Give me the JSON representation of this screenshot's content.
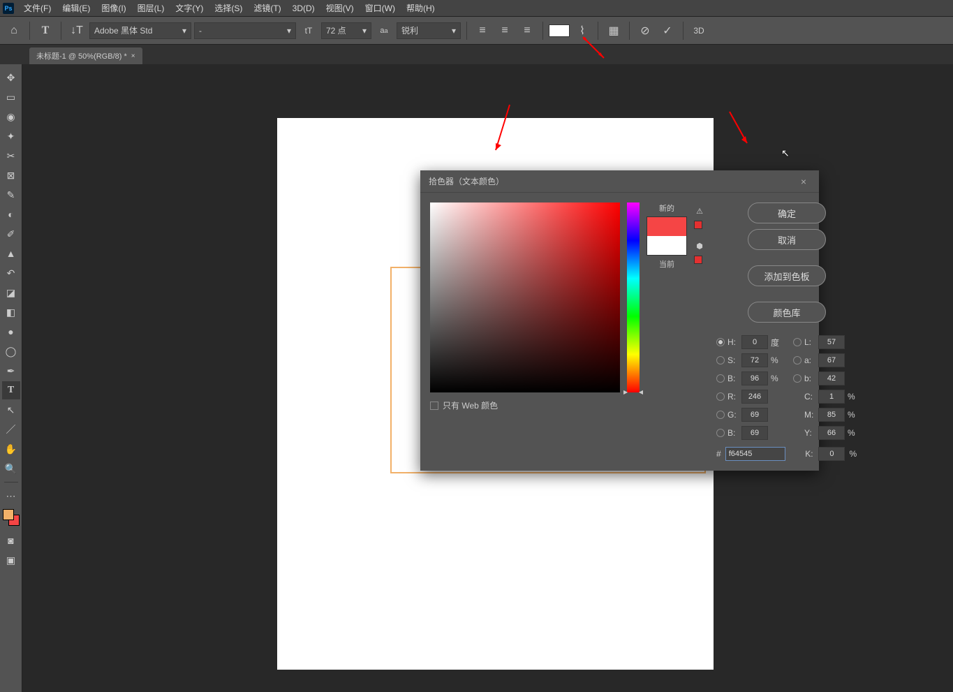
{
  "menu": {
    "file": "文件(F)",
    "edit": "编辑(E)",
    "image": "图像(I)",
    "layer": "图层(L)",
    "type": "文字(Y)",
    "select": "选择(S)",
    "filter": "滤镜(T)",
    "threeD": "3D(D)",
    "view": "视图(V)",
    "window": "窗口(W)",
    "help": "帮助(H)"
  },
  "optbar": {
    "font": "Adobe 黑体 Std",
    "fontStyle": "-",
    "size": "72 点",
    "aa": "锐利",
    "threeD": "3D"
  },
  "tab": {
    "title": "未标题-1 @ 50%(RGB/8) *"
  },
  "dialog": {
    "title": "拾色器（文本颜色）",
    "ok": "确定",
    "cancel": "取消",
    "addSwatch": "添加到色板",
    "colorLib": "颜色库",
    "newLabel": "新的",
    "curLabel": "当前",
    "webOnly": "只有 Web 颜色",
    "labels": {
      "H": "H:",
      "S": "S:",
      "Bv": "B:",
      "L": "L:",
      "a": "a:",
      "b": "b:",
      "R": "R:",
      "G": "G:",
      "Bb": "B:",
      "C": "C:",
      "M": "M:",
      "Y": "Y:",
      "K": "K:",
      "deg": "度",
      "pct": "%",
      "hash": "#"
    },
    "vals": {
      "H": "0",
      "S": "72",
      "Bv": "96",
      "L": "57",
      "a": "67",
      "b": "42",
      "R": "246",
      "G": "69",
      "Bb": "69",
      "C": "1",
      "M": "85",
      "Y": "66",
      "K": "0",
      "hex": "f64545"
    }
  }
}
